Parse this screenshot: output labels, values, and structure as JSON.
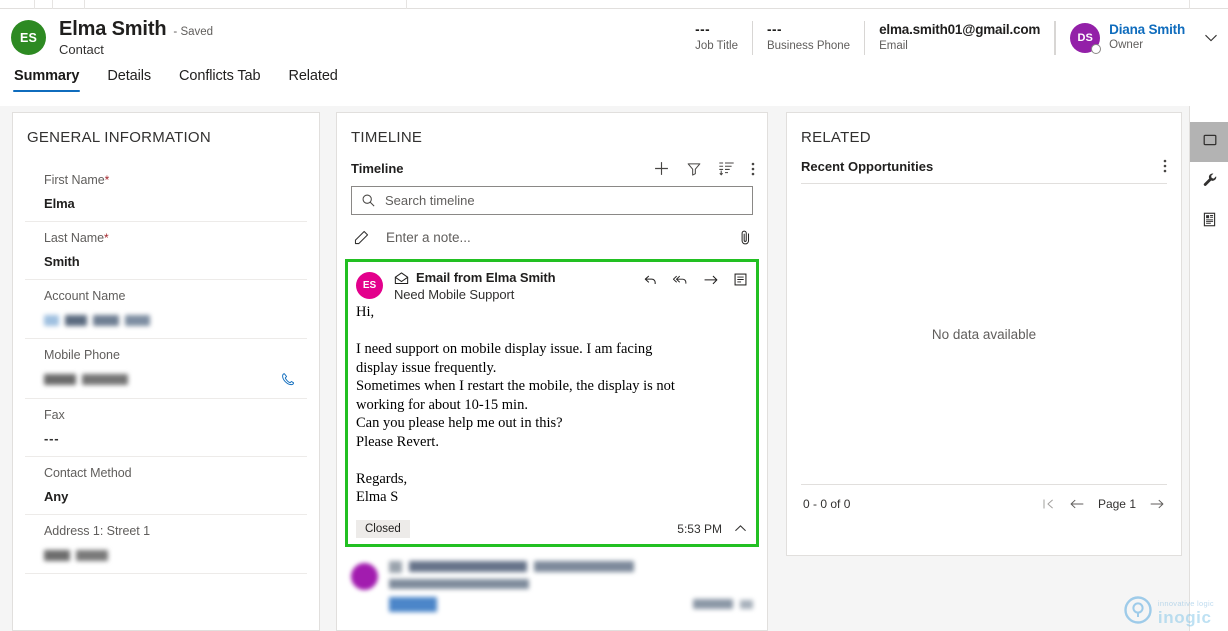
{
  "header": {
    "avatar_initials": "ES",
    "entity_name": "Elma Smith",
    "saved_state": "- Saved",
    "entity_type": "Contact",
    "fields": [
      {
        "value": "---",
        "label": "Job Title"
      },
      {
        "value": "---",
        "label": "Business Phone"
      },
      {
        "value": "elma.smith01@gmail.com",
        "label": "Email"
      }
    ],
    "owner": {
      "avatar_initials": "DS",
      "name": "Diana Smith",
      "role": "Owner"
    }
  },
  "tabs": [
    {
      "label": "Summary",
      "active": true
    },
    {
      "label": "Details",
      "active": false
    },
    {
      "label": "Conflicts Tab",
      "active": false
    },
    {
      "label": "Related",
      "active": false
    }
  ],
  "general_information": {
    "section_title": "GENERAL INFORMATION",
    "fields": [
      {
        "label": "First Name",
        "required": true,
        "value": "Elma",
        "redacted": false
      },
      {
        "label": "Last Name",
        "required": true,
        "value": "Smith",
        "redacted": false
      },
      {
        "label": "Account Name",
        "required": false,
        "value": "",
        "redacted": true
      },
      {
        "label": "Mobile Phone",
        "required": false,
        "value": "",
        "redacted": true,
        "action_icon": "phone-icon"
      },
      {
        "label": "Fax",
        "required": false,
        "value": "---",
        "redacted": false
      },
      {
        "label": "Contact Method",
        "required": false,
        "value": "Any",
        "redacted": false
      },
      {
        "label": "Address 1: Street 1",
        "required": false,
        "value": "",
        "redacted": true
      }
    ]
  },
  "timeline": {
    "section_title": "TIMELINE",
    "subheader_label": "Timeline",
    "toolbar_icons": [
      "add-icon",
      "filter-icon",
      "sort-icon",
      "more-options-icon"
    ],
    "search_placeholder": "Search timeline",
    "search_value": "",
    "note_placeholder": "Enter a note...",
    "note_value": "",
    "attachment_icon": "attachment-icon",
    "email_card": {
      "highlighted": true,
      "highlight_color": "#22c022",
      "avatar_initials": "ES",
      "title": "Email from Elma Smith",
      "subject": "Need Mobile Support",
      "body": "Hi,\n\nI need support on mobile display issue. I am facing\ndisplay issue frequently.\nSometimes when I restart the mobile, the display is not\nworking for about 10-15 min.\nCan you please help me out in this?\nPlease Revert.\n\nRegards,\nElma S",
      "actions": [
        "reply-icon",
        "reply-all-icon",
        "forward-icon",
        "convert-to-note-icon"
      ],
      "status_badge": "Closed",
      "time": "5:53 PM",
      "collapse_icon": "chevron-up-icon"
    },
    "blurred_item": {
      "redacted": true,
      "avatar_color": "#a21caf",
      "badge_color": "#bcdcf5"
    }
  },
  "related": {
    "section_title": "RELATED",
    "subgrid_label": "Recent Opportunities",
    "more_icon": "more-options-icon",
    "empty_message": "No data available",
    "record_count": "0 - 0 of 0",
    "page_label": "Page 1",
    "pager_icons": [
      "first-page-icon",
      "previous-page-icon",
      "next-page-icon"
    ]
  },
  "rail": {
    "buttons": [
      {
        "icon": "panel-icon",
        "active": true
      },
      {
        "icon": "wrench-icon",
        "active": false
      },
      {
        "icon": "form-document-icon",
        "active": false
      }
    ]
  },
  "watermark": {
    "tagline": "innovative logic",
    "name": "inogic"
  },
  "colors": {
    "accent_blue": "#0f6cbd",
    "highlight_green": "#22c022",
    "contact_avatar_green": "#2d8a22",
    "owner_avatar_purple": "#9320a8",
    "email_avatar_pink": "#e3008c",
    "required_red": "#a4262c"
  }
}
